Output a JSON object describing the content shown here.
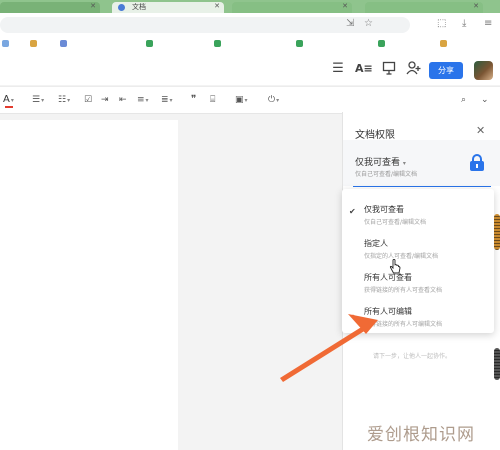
{
  "browser": {
    "tabs": [
      {
        "label": ""
      },
      {
        "label": "文档"
      },
      {
        "label": ""
      },
      {
        "label": ""
      }
    ]
  },
  "app_header": {
    "share_label": "分享"
  },
  "panel": {
    "title": "文档权限",
    "current": {
      "title": "仅我可查看",
      "desc": "仅自己可查看/编辑文档"
    },
    "hint": "请下一步，让他人一起协作。"
  },
  "dropdown": {
    "options": [
      {
        "title": "仅我可查看",
        "desc": "仅自己可查看/编辑文档",
        "selected": true
      },
      {
        "title": "指定人",
        "desc": "仅指定的人可查看/编辑文档",
        "selected": false
      },
      {
        "title": "所有人可查看",
        "desc": "获得链接的所有人可查看文档",
        "selected": false
      },
      {
        "title": "所有人可编辑",
        "desc": "获得链接的所有人可编辑文档",
        "selected": false
      }
    ]
  },
  "watermark": "爱创根知识网",
  "colors": {
    "accent": "#2a74ea",
    "arrow": "#f06a35",
    "tab_bar": "#8fc48d"
  },
  "icons": {
    "menu": "menu-icon",
    "font": "text-format-icon",
    "present": "present-icon",
    "add_user": "add-user-icon",
    "lock": "lock-icon",
    "close": "close-icon",
    "check": "check-icon"
  }
}
